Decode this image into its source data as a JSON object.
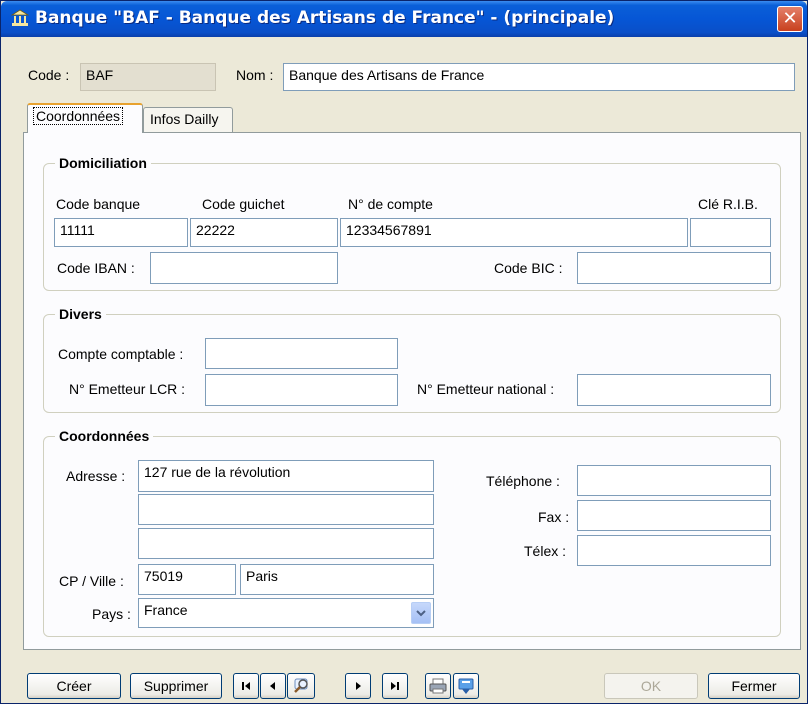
{
  "window": {
    "title": "Banque \"BAF - Banque des Artisans de France\" - (principale)",
    "close_label": "✕"
  },
  "header": {
    "code_label": "Code :",
    "code_value": "BAF",
    "nom_label": "Nom :",
    "nom_value": "Banque des Artisans de France"
  },
  "tabs": [
    {
      "label": "Coordonnées",
      "active": true
    },
    {
      "label": "Infos Dailly",
      "active": false
    }
  ],
  "domiciliation": {
    "title": "Domiciliation",
    "code_banque_label": "Code banque",
    "code_banque_value": "11111",
    "code_guichet_label": "Code guichet",
    "code_guichet_value": "22222",
    "num_compte_label": "N° de compte",
    "num_compte_value": "12334567891",
    "cle_rib_label": "Clé R.I.B.",
    "cle_rib_value": "",
    "iban_label": "Code IBAN :",
    "iban_value": "",
    "bic_label": "Code BIC :",
    "bic_value": ""
  },
  "divers": {
    "title": "Divers",
    "compte_comptable_label": "Compte comptable :",
    "compte_comptable_value": "",
    "emetteur_lcr_label": "N° Emetteur LCR :",
    "emetteur_lcr_value": "",
    "emetteur_national_label": "N° Emetteur national :",
    "emetteur_national_value": ""
  },
  "coordonnees": {
    "title": "Coordonnées",
    "adresse_label": "Adresse :",
    "adresse_1": "127 rue de la révolution",
    "adresse_2": "",
    "adresse_3": "",
    "cp_ville_label": "CP / Ville :",
    "cp_value": "75019",
    "ville_value": "Paris",
    "pays_label": "Pays :",
    "pays_value": "France",
    "telephone_label": "Téléphone :",
    "telephone_value": "",
    "fax_label": "Fax :",
    "fax_value": "",
    "telex_label": "Télex :",
    "telex_value": ""
  },
  "buttons": {
    "creer": "Créer",
    "supprimer": "Supprimer",
    "ok": "OK",
    "fermer": "Fermer"
  },
  "icons": {
    "title_icon": "bank-icon",
    "nav": [
      "first-record-icon",
      "previous-record-icon",
      "search-icon",
      "next-record-icon",
      "last-record-icon"
    ],
    "tools": [
      "print-icon",
      "export-icon"
    ]
  }
}
